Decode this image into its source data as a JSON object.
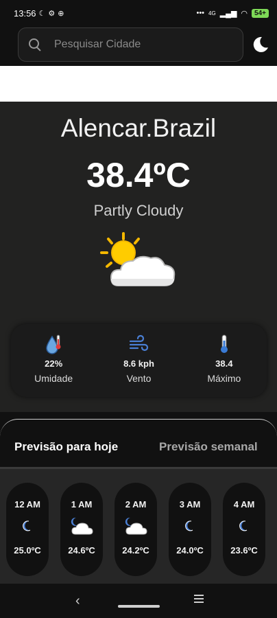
{
  "status_bar": {
    "time": "13:56",
    "network": "4G",
    "battery": "54+"
  },
  "search": {
    "placeholder": "Pesquisar Cidade",
    "value": ""
  },
  "current": {
    "city": "Alencar.Brazil",
    "temperature": "38.4ºC",
    "condition": "Partly Cloudy",
    "icon": "partly-cloudy-sun-icon"
  },
  "stats": [
    {
      "icon": "humidity-icon",
      "value": "22%",
      "label": "Umidade"
    },
    {
      "icon": "wind-icon",
      "value": "8.6 kph",
      "label": "Vento"
    },
    {
      "icon": "thermometer-icon",
      "value": "38.4",
      "label": "Máximo"
    }
  ],
  "tabs": {
    "today": "Previsão para hoje",
    "week": "Previsão semanal"
  },
  "hourly": [
    {
      "time": "12 AM",
      "icon": "moon-icon",
      "temp": "25.0ºC"
    },
    {
      "time": "1 AM",
      "icon": "partly-cloudy-night-icon",
      "temp": "24.6ºC"
    },
    {
      "time": "2 AM",
      "icon": "partly-cloudy-night-icon",
      "temp": "24.2ºC"
    },
    {
      "time": "3 AM",
      "icon": "moon-icon",
      "temp": "24.0ºC"
    },
    {
      "time": "4 AM",
      "icon": "moon-icon",
      "temp": "23.6ºC"
    }
  ],
  "colors": {
    "background": "#111111",
    "card": "#222221",
    "accent_blue": "#4a7fd4",
    "battery": "#7ed957"
  }
}
